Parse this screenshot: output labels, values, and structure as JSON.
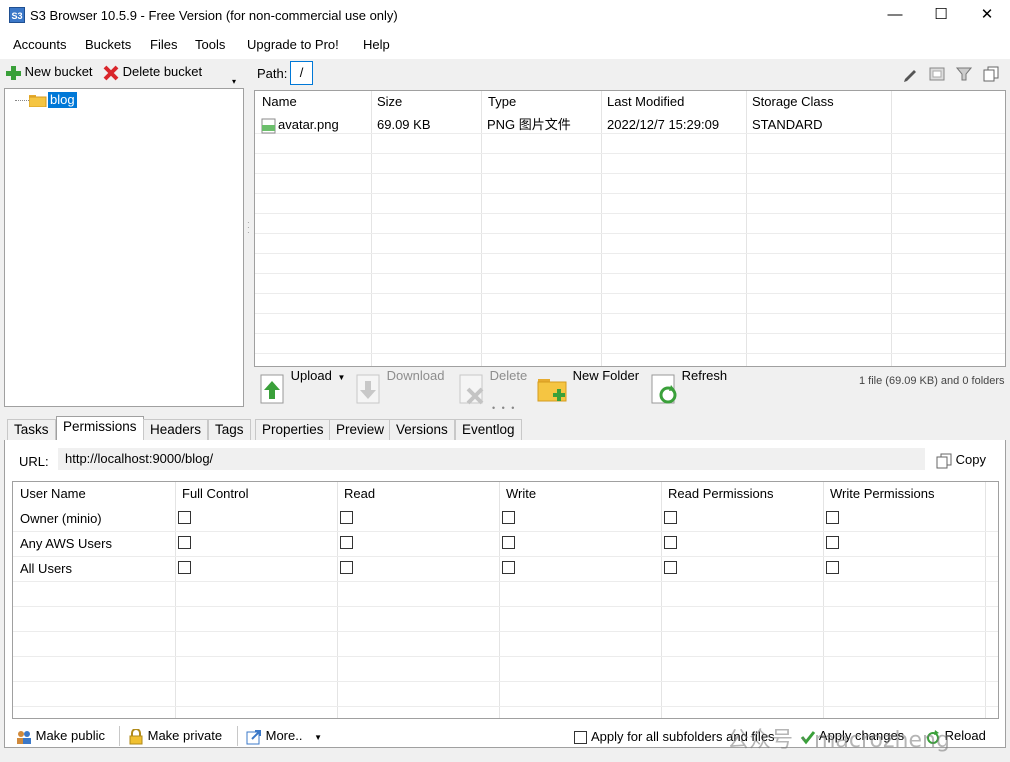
{
  "window": {
    "title": "S3 Browser 10.5.9 - Free Version (for non-commercial use only)",
    "app_icon": "S3",
    "minimize": "—",
    "maximize": "☐",
    "close": "✕"
  },
  "menu": [
    "Accounts",
    "Buckets",
    "Files",
    "Tools",
    "Upgrade to Pro!",
    "Help"
  ],
  "bucket_toolbar": {
    "new_bucket": "New bucket",
    "delete_bucket": "Delete bucket"
  },
  "tree": {
    "root": "blog"
  },
  "path": {
    "label": "Path:",
    "value": "/"
  },
  "file_table": {
    "headers": [
      "Name",
      "Size",
      "Type",
      "Last Modified",
      "Storage Class"
    ],
    "rows": [
      {
        "name": "avatar.png",
        "size": "69.09 KB",
        "type": "PNG 图片文件",
        "modified": "2022/12/7 15:29:09",
        "storage": "STANDARD"
      }
    ]
  },
  "file_toolbar": {
    "upload": "Upload",
    "download": "Download",
    "delete": "Delete",
    "new_folder": "New Folder",
    "refresh": "Refresh",
    "status": "1 file (69.09 KB) and 0 folders"
  },
  "tabs": [
    "Tasks",
    "Permissions",
    "Headers",
    "Tags",
    "Properties",
    "Preview",
    "Versions",
    "Eventlog"
  ],
  "active_tab": "Permissions",
  "url": {
    "label": "URL:",
    "value": "http://localhost:9000/blog/",
    "copy": "Copy"
  },
  "perm_table": {
    "headers": [
      "User Name",
      "Full Control",
      "Read",
      "Write",
      "Read Permissions",
      "Write Permissions"
    ],
    "rows": [
      {
        "user": "Owner (minio)"
      },
      {
        "user": "Any AWS Users"
      },
      {
        "user": "All Users"
      }
    ]
  },
  "bottom": {
    "make_public": "Make public",
    "make_private": "Make private",
    "more": "More..",
    "apply_all": "Apply for all subfolders and files",
    "apply_changes": "Apply changes",
    "reload": "Reload"
  },
  "watermark": "公众号 · macrozheng",
  "colors": {
    "selection": "#0078d7",
    "accent_green": "#3aa03a",
    "delete_red": "#d9262b",
    "folder_yellow": "#f5c542"
  }
}
